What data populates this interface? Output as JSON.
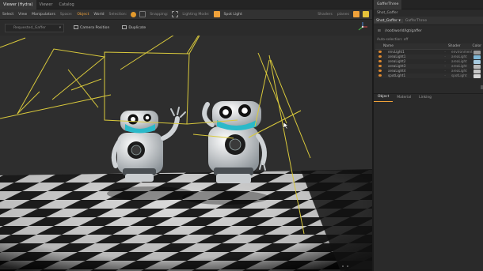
{
  "viewer": {
    "tabs": [
      "Viewer (Hydra)",
      "Viewer",
      "Catalog"
    ],
    "toolbar": {
      "items": [
        "Select",
        "View",
        "Manipulators",
        "Space:",
        "Object",
        "World",
        "Selection:",
        "Snapping:",
        "Lighting Mode:",
        "Spot Light"
      ],
      "right_items": [
        "Shaders",
        "planes"
      ]
    },
    "viewbar": {
      "select_value": "Requested_Gaffer",
      "camera_position": "Camera Position",
      "duplicate": "Duplicate"
    }
  },
  "panel": {
    "tab": "GafferThree",
    "subtitle": "Shot_Gaffer",
    "bar": [
      "Shot_Gaffer ▾",
      "GafferThree"
    ],
    "path": "/root/world/lgt/gaffer",
    "auto_selection": "Auto-selection: off",
    "columns": [
      "Name",
      "Shader",
      "Color"
    ],
    "rows": [
      {
        "name": "envLight1",
        "shader": "environment",
        "color": "#9c9c9c"
      },
      {
        "name": "areaLight1",
        "shader": "areaLight",
        "color": "#7fb7d6"
      },
      {
        "name": "areaLight2",
        "shader": "areaLight",
        "color": "#a6c9de"
      },
      {
        "name": "areaLight3",
        "shader": "areaLight",
        "color": "#b9b9b9"
      },
      {
        "name": "areaLight4",
        "shader": "areaLight",
        "color": "#c7c7c7"
      },
      {
        "name": "spotLight1",
        "shader": "spotLight",
        "color": "#d7d7d7"
      }
    ],
    "bottom_tabs": [
      "Object",
      "Material",
      "Linking"
    ]
  },
  "colors": {
    "accent": "#f0a23a",
    "light_lines": "#d9c93c",
    "robot_screen": "#2bb9c9"
  }
}
